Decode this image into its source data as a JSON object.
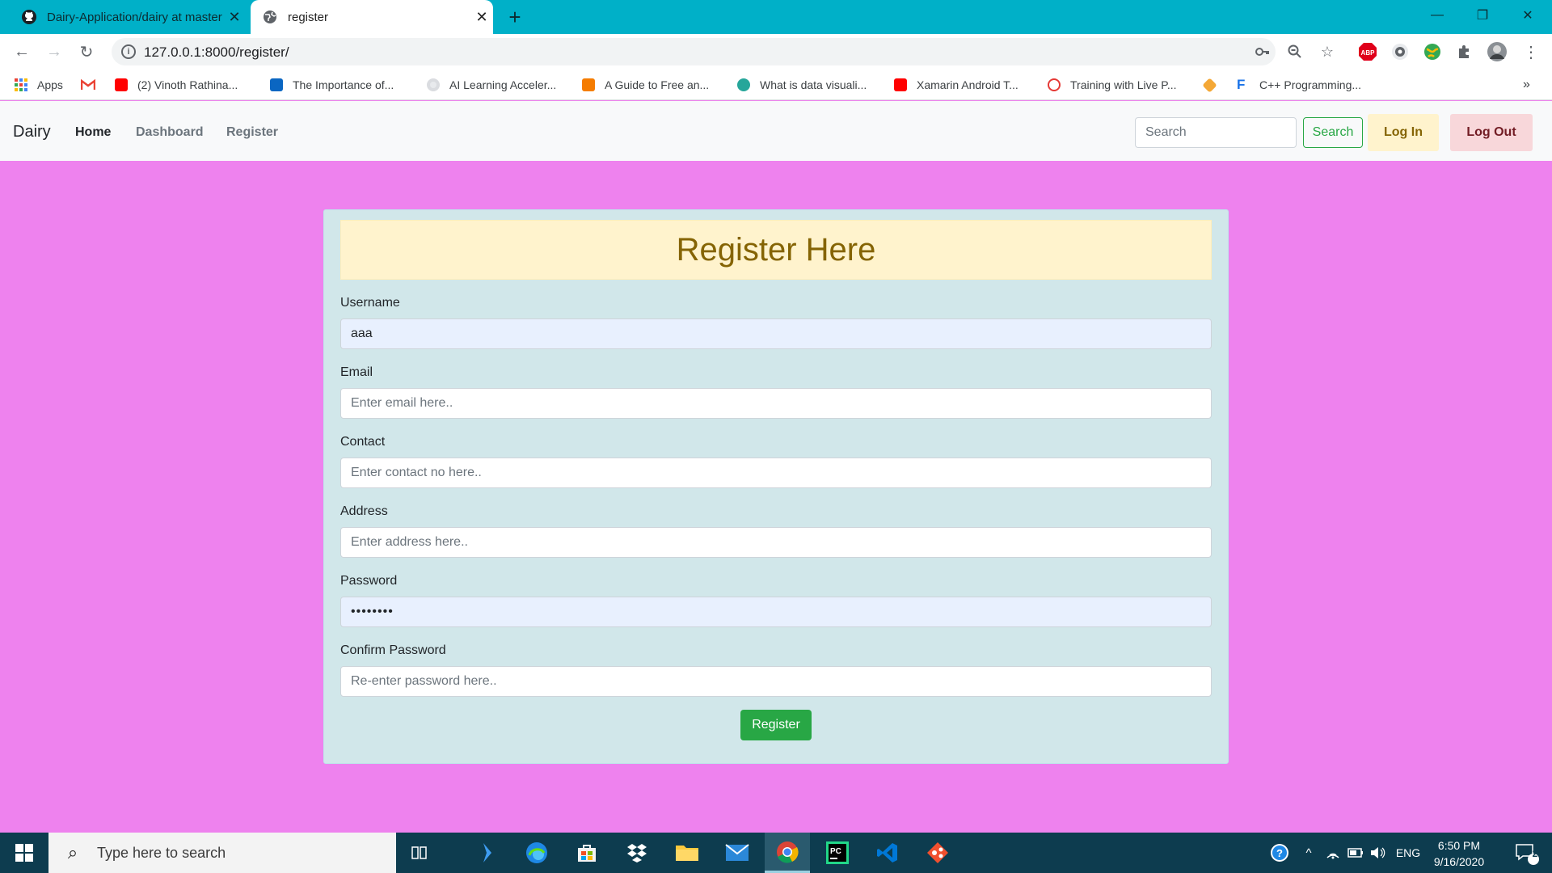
{
  "browser": {
    "tabs": [
      {
        "title": "Dairy-Application/dairy at master",
        "icon": "github-icon"
      },
      {
        "title": "register",
        "icon": "globe-icon"
      }
    ],
    "address": "127.0.0.1:8000/register/",
    "bookmarks": [
      {
        "label": "Apps",
        "icon": "apps-grid-icon"
      },
      {
        "label": "",
        "icon": "gmail-icon"
      },
      {
        "label": "(2) Vinoth Rathina...",
        "icon": "youtube-icon"
      },
      {
        "label": "The Importance of...",
        "icon": "linkedin-icon"
      },
      {
        "label": "AI Learning Acceler...",
        "icon": "dot-icon"
      },
      {
        "label": "A Guide to Free an...",
        "icon": "chat-icon"
      },
      {
        "label": "What is data visuali...",
        "icon": "eye-icon"
      },
      {
        "label": "Xamarin Android T...",
        "icon": "youtube-icon"
      },
      {
        "label": "Training with Live P...",
        "icon": "swirl-icon"
      },
      {
        "label": "",
        "icon": "diamond-icon"
      },
      {
        "label": "C++ Programming...",
        "icon": "f-icon"
      }
    ],
    "bookmarks_more": "»"
  },
  "site": {
    "brand": "Dairy",
    "nav": [
      "Home",
      "Dashboard",
      "Register"
    ],
    "search_placeholder": "Search",
    "search_button": "Search",
    "login": "Log In",
    "logout": "Log Out"
  },
  "form": {
    "heading": "Register Here",
    "fields": [
      {
        "label": "Username",
        "value": "aaa",
        "placeholder": ""
      },
      {
        "label": "Email",
        "value": "",
        "placeholder": "Enter email here.."
      },
      {
        "label": "Contact",
        "value": "",
        "placeholder": "Enter contact no here.."
      },
      {
        "label": "Address",
        "value": "",
        "placeholder": "Enter address here.."
      },
      {
        "label": "Password",
        "value": "••••••••",
        "placeholder": ""
      },
      {
        "label": "Confirm Password",
        "value": "",
        "placeholder": "Re-enter password here.."
      }
    ],
    "submit": "Register"
  },
  "taskbar": {
    "search_placeholder": "Type here to search",
    "language": "ENG",
    "time": "6:50 PM",
    "date": "9/16/2020",
    "notifications": "2"
  },
  "colors": {
    "page_bg": "#ee82ee",
    "card_bg": "#d1e7ea",
    "heading_bg": "#fff3cd",
    "heading_text": "#856404",
    "register_button": "#28a745",
    "tab_strip": "#00b0c8",
    "taskbar": "#0d3c4f"
  }
}
